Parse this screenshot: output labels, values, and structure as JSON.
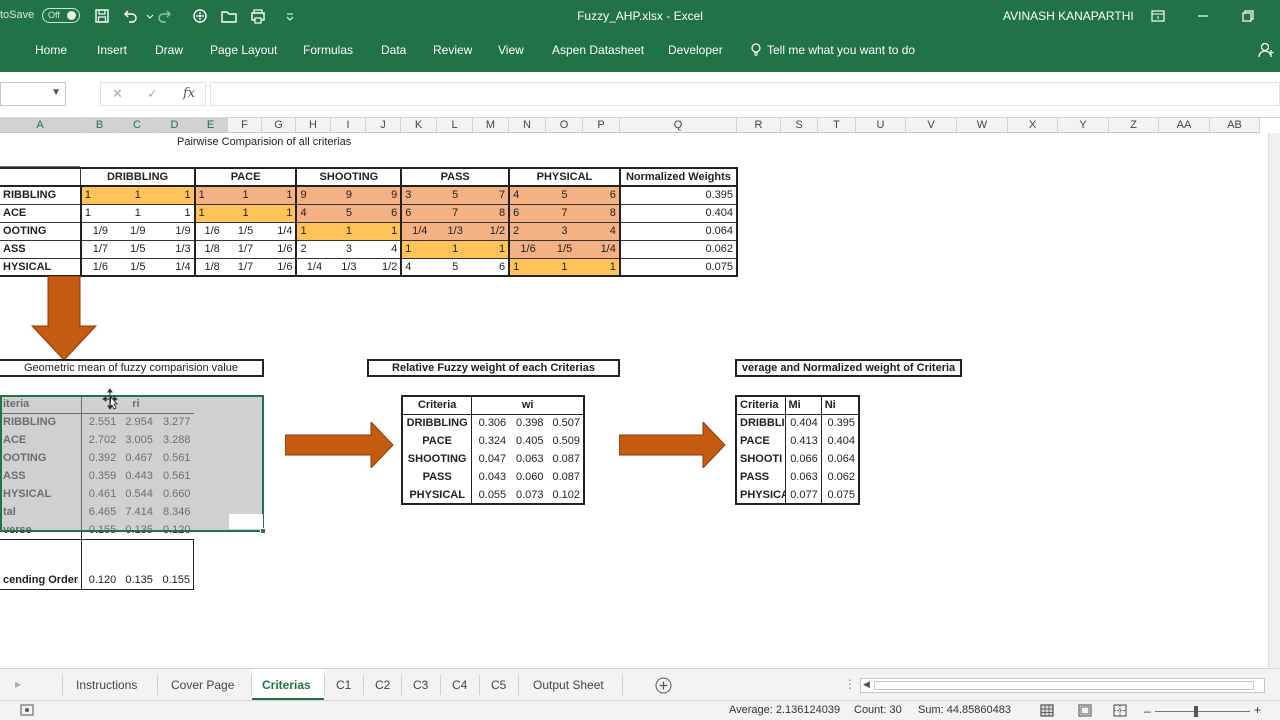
{
  "window": {
    "title": "Fuzzy_AHP.xlsx  -  Excel",
    "autosave_label": "toSave",
    "autosave_state": "Off",
    "user": "AVINASH KANAPARTHI"
  },
  "ribbon": {
    "tabs": [
      "Home",
      "Insert",
      "Draw",
      "Page Layout",
      "Formulas",
      "Data",
      "Review",
      "View",
      "Aspen Datasheet",
      "Developer"
    ],
    "tell_me": "Tell me what you want to do"
  },
  "formula_bar": {
    "fx": "fx",
    "cancel": "✕",
    "enter": "✓"
  },
  "columns": [
    "A",
    "B",
    "C",
    "D",
    "E",
    "F",
    "G",
    "H",
    "I",
    "J",
    "K",
    "L",
    "M",
    "N",
    "O",
    "P",
    "Q",
    "R",
    "S",
    "T",
    "U",
    "V",
    "W",
    "X",
    "Y",
    "Z",
    "AA",
    "AB"
  ],
  "pairwise": {
    "title": "Pairwise Comparision of all criterias",
    "headers": [
      "DRIBBLING",
      "PACE",
      "SHOOTING",
      "PASS",
      "PHYSICAL",
      "Normalized Weights"
    ],
    "rows": [
      {
        "label": "RIBBLING",
        "cells": [
          "1",
          "1",
          "1",
          "1",
          "1",
          "1",
          "9",
          "9",
          "9",
          "3",
          "5",
          "7",
          "4",
          "5",
          "6"
        ],
        "weight": "0.395"
      },
      {
        "label": "ACE",
        "cells": [
          "1",
          "1",
          "1",
          "1",
          "1",
          "1",
          "4",
          "5",
          "6",
          "6",
          "7",
          "8",
          "6",
          "7",
          "8"
        ],
        "weight": "0.404"
      },
      {
        "label": "OOTING",
        "cells": [
          "1/9",
          "1/9",
          "1/9",
          "1/6",
          "1/5",
          "1/4",
          "1",
          "1",
          "1",
          "1/4",
          "1/3",
          "1/2",
          "2",
          "3",
          "4"
        ],
        "weight": "0.064"
      },
      {
        "label": "ASS",
        "cells": [
          "1/7",
          "1/5",
          "1/3",
          "1/8",
          "1/7",
          "1/6",
          "2",
          "3",
          "4",
          "1",
          "1",
          "1",
          "1/6",
          "1/5",
          "1/4"
        ],
        "weight": "0.062"
      },
      {
        "label": "HYSICAL",
        "cells": [
          "1/6",
          "1/5",
          "1/4",
          "1/8",
          "1/7",
          "1/6",
          "1/4",
          "1/3",
          "1/2",
          "4",
          "5",
          "6",
          "1",
          "1",
          "1"
        ],
        "weight": "0.075"
      }
    ]
  },
  "geo_mean": {
    "title": "Geometric mean of fuzzy comparision value",
    "col_criteria": "iteria",
    "col_ri": "ri",
    "rows": [
      {
        "label": "RIBBLING",
        "v": [
          "2.551",
          "2.954",
          "3.277"
        ]
      },
      {
        "label": "ACE",
        "v": [
          "2.702",
          "3.005",
          "3.288"
        ]
      },
      {
        "label": "OOTING",
        "v": [
          "0.392",
          "0.467",
          "0.561"
        ]
      },
      {
        "label": "ASS",
        "v": [
          "0.359",
          "0.443",
          "0.561"
        ]
      },
      {
        "label": "HYSICAL",
        "v": [
          "0.461",
          "0.544",
          "0.660"
        ]
      },
      {
        "label": "tal",
        "v": [
          "6.465",
          "7.414",
          "8.346"
        ]
      },
      {
        "label": "verse",
        "v": [
          "0.155",
          "0.135",
          "0.120"
        ]
      }
    ],
    "ascending_label": "cending Order",
    "ascending": [
      "0.120",
      "0.135",
      "0.155"
    ]
  },
  "relative": {
    "title": "Relative Fuzzy weight of each Criterias",
    "col_criteria": "Criteria",
    "col_wi": "wi",
    "rows": [
      {
        "label": "DRIBBLING",
        "v": [
          "0.306",
          "0.398",
          "0.507"
        ]
      },
      {
        "label": "PACE",
        "v": [
          "0.324",
          "0.405",
          "0.509"
        ]
      },
      {
        "label": "SHOOTING",
        "v": [
          "0.047",
          "0.063",
          "0.087"
        ]
      },
      {
        "label": "PASS",
        "v": [
          "0.043",
          "0.060",
          "0.087"
        ]
      },
      {
        "label": "PHYSICAL",
        "v": [
          "0.055",
          "0.073",
          "0.102"
        ]
      }
    ]
  },
  "average": {
    "title": "verage and Normalized weight of Criteria",
    "col_criteria": "Criteria",
    "col_mi": "Mi",
    "col_ni": "Ni",
    "rows": [
      {
        "label": "DRIBBLI",
        "mi": "0.404",
        "ni": "0.395"
      },
      {
        "label": "PACE",
        "mi": "0.413",
        "ni": "0.404"
      },
      {
        "label": "SHOOTI",
        "mi": "0.066",
        "ni": "0.064"
      },
      {
        "label": "PASS",
        "mi": "0.063",
        "ni": "0.062"
      },
      {
        "label": "PHYSICA",
        "mi": "0.077",
        "ni": "0.075"
      }
    ]
  },
  "sheets": [
    "Instructions",
    "Cover Page",
    "Criterias",
    "C1",
    "C2",
    "C3",
    "C4",
    "C5",
    "Output Sheet"
  ],
  "status": {
    "average": "Average: 2.136124039",
    "count": "Count: 30",
    "sum": "Sum: 44.85860483"
  },
  "colors": {
    "excel_green": "#217346",
    "cell_yellow": "#ffc35a",
    "cell_orange": "#f4b183",
    "arrow": "#c55a11"
  }
}
